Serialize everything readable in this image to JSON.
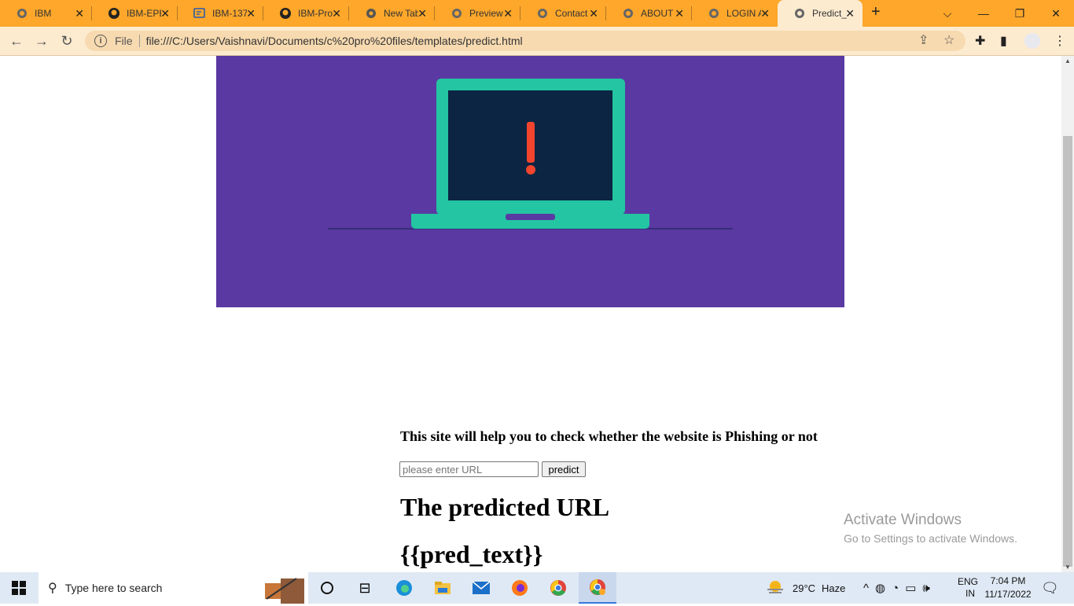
{
  "browser": {
    "tabs": [
      {
        "label": "IBM",
        "icon": "globe-icon"
      },
      {
        "label": "IBM-EPE",
        "icon": "github-icon"
      },
      {
        "label": "IBM-137",
        "icon": "doc-edit-icon"
      },
      {
        "label": "IBM-Pro",
        "icon": "github-icon"
      },
      {
        "label": "New Tab",
        "icon": "chrome-icon"
      },
      {
        "label": "Preview",
        "icon": "globe-icon"
      },
      {
        "label": "Contact",
        "icon": "globe-icon"
      },
      {
        "label": "ABOUT",
        "icon": "globe-icon"
      },
      {
        "label": "LOGIN A",
        "icon": "globe-icon"
      },
      {
        "label": "Predict_",
        "icon": "globe-icon"
      }
    ],
    "file_label": "File",
    "url": "file:///C:/Users/Vaishnavi/Documents/c%20pro%20files/templates/predict.html"
  },
  "page": {
    "heading": "This site will help you to check whether the website is Phishing or not",
    "url_placeholder": "please enter URL",
    "predict_button": "predict",
    "predicted_heading": "The predicted URL",
    "pred_text": "{{pred_text}}"
  },
  "watermark": {
    "line1": "Activate Windows",
    "line2": "Go to Settings to activate Windows."
  },
  "taskbar": {
    "search_placeholder": "Type here to search",
    "weather_temp": "29°C",
    "weather_desc": "Haze",
    "lang_top": "ENG",
    "lang_bottom": "IN",
    "time": "7:04 PM",
    "date": "11/17/2022"
  },
  "colors": {
    "tabbar": "#fea72a",
    "toolbar": "#fdebd0",
    "hero": "#5a39a2",
    "laptop": "#24c5a2",
    "screen": "#0b2543",
    "alert": "#f2452e"
  }
}
